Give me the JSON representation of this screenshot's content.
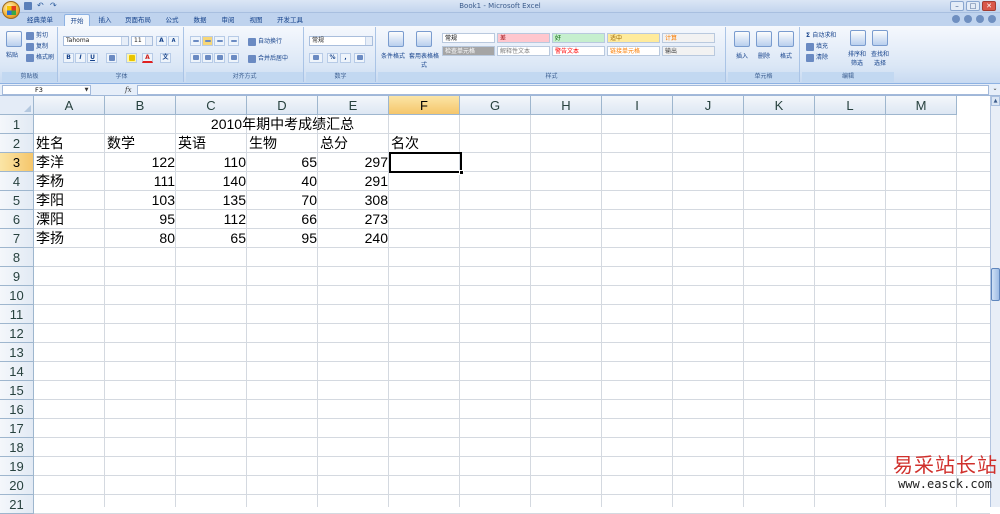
{
  "window": {
    "title": "Book1 - Microsoft Excel",
    "controls": [
      "–",
      "□",
      "✕"
    ]
  },
  "tabs": [
    "经典菜单",
    "开始",
    "插入",
    "页面布局",
    "公式",
    "数据",
    "审阅",
    "视图",
    "开发工具"
  ],
  "active_tab_index": 1,
  "ribbon": {
    "clipboard": {
      "paste_label": "粘贴",
      "cut_label": "剪切",
      "copy_label": "复制",
      "format_painter_label": "格式刷",
      "group_label": "剪贴板"
    },
    "font": {
      "font_name": "Tahoma",
      "font_size": "11",
      "bold": "B",
      "italic": "I",
      "underline": "U",
      "grow": "A",
      "shrink": "A",
      "font_color": "A",
      "wen": "文",
      "group_label": "字体"
    },
    "alignment": {
      "wrap_label": "自动换行",
      "merge_label": "合并后居中",
      "group_label": "对齐方式"
    },
    "number": {
      "format": "常规",
      "percent": "%",
      "comma": ",",
      "group_label": "数字"
    },
    "styles": {
      "conditional_label": "条件格式",
      "table_label": "套用表格格式",
      "cells": [
        {
          "label": "常规",
          "bg": "#ffffff",
          "fg": "#000000"
        },
        {
          "label": "差",
          "bg": "#ffc7ce",
          "fg": "#9c0006"
        },
        {
          "label": "好",
          "bg": "#c6efce",
          "fg": "#006100"
        },
        {
          "label": "适中",
          "bg": "#ffeb9c",
          "fg": "#9c6500"
        },
        {
          "label": "计算",
          "bg": "#f2f2f2",
          "fg": "#fa7d00"
        },
        {
          "label": "检查单元格",
          "bg": "#a5a5a5",
          "fg": "#ffffff"
        },
        {
          "label": "解释性文本",
          "bg": "#ffffff",
          "fg": "#7f7f7f"
        },
        {
          "label": "警告文本",
          "bg": "#ffffff",
          "fg": "#ff0000"
        },
        {
          "label": "链接单元格",
          "bg": "#ffffff",
          "fg": "#fa7d00"
        },
        {
          "label": "输出",
          "bg": "#f2f2f2",
          "fg": "#3f3f3f"
        }
      ],
      "group_label": "样式"
    },
    "cells_group": {
      "insert_label": "插入",
      "delete_label": "删除",
      "format_label": "格式",
      "group_label": "单元格"
    },
    "editing": {
      "autosum_label": "自动求和",
      "fill_label": "填充",
      "clear_label": "清除",
      "sort_label": "排序和筛选",
      "find_label": "查找和选择",
      "group_label": "编辑"
    }
  },
  "formula_bar": {
    "name_box": "F3",
    "fx": "fx",
    "formula": ""
  },
  "sheet": {
    "columns": [
      "A",
      "B",
      "C",
      "D",
      "E",
      "F",
      "G",
      "H",
      "I",
      "J",
      "K",
      "L",
      "M"
    ],
    "rows": [
      "1",
      "2",
      "3",
      "4",
      "5",
      "6",
      "7",
      "8",
      "9",
      "10",
      "11",
      "12",
      "13",
      "14",
      "15",
      "16",
      "17",
      "18",
      "19",
      "20",
      "21"
    ],
    "title": "2010年期中考成绩汇总",
    "headers": [
      "姓名",
      "数学",
      "英语",
      "生物",
      "总分",
      "名次"
    ],
    "records": [
      [
        "李洋",
        "122",
        "110",
        "65",
        "297"
      ],
      [
        "李杨",
        "111",
        "140",
        "40",
        "291"
      ],
      [
        "李阳",
        "103",
        "135",
        "70",
        "308"
      ],
      [
        "溧阳",
        "95",
        "112",
        "66",
        "273"
      ],
      [
        "李扬",
        "80",
        "65",
        "95",
        "240"
      ]
    ],
    "active_cell": "F3"
  },
  "watermark": {
    "text": "易采站长站",
    "url": "www.easck.com"
  }
}
